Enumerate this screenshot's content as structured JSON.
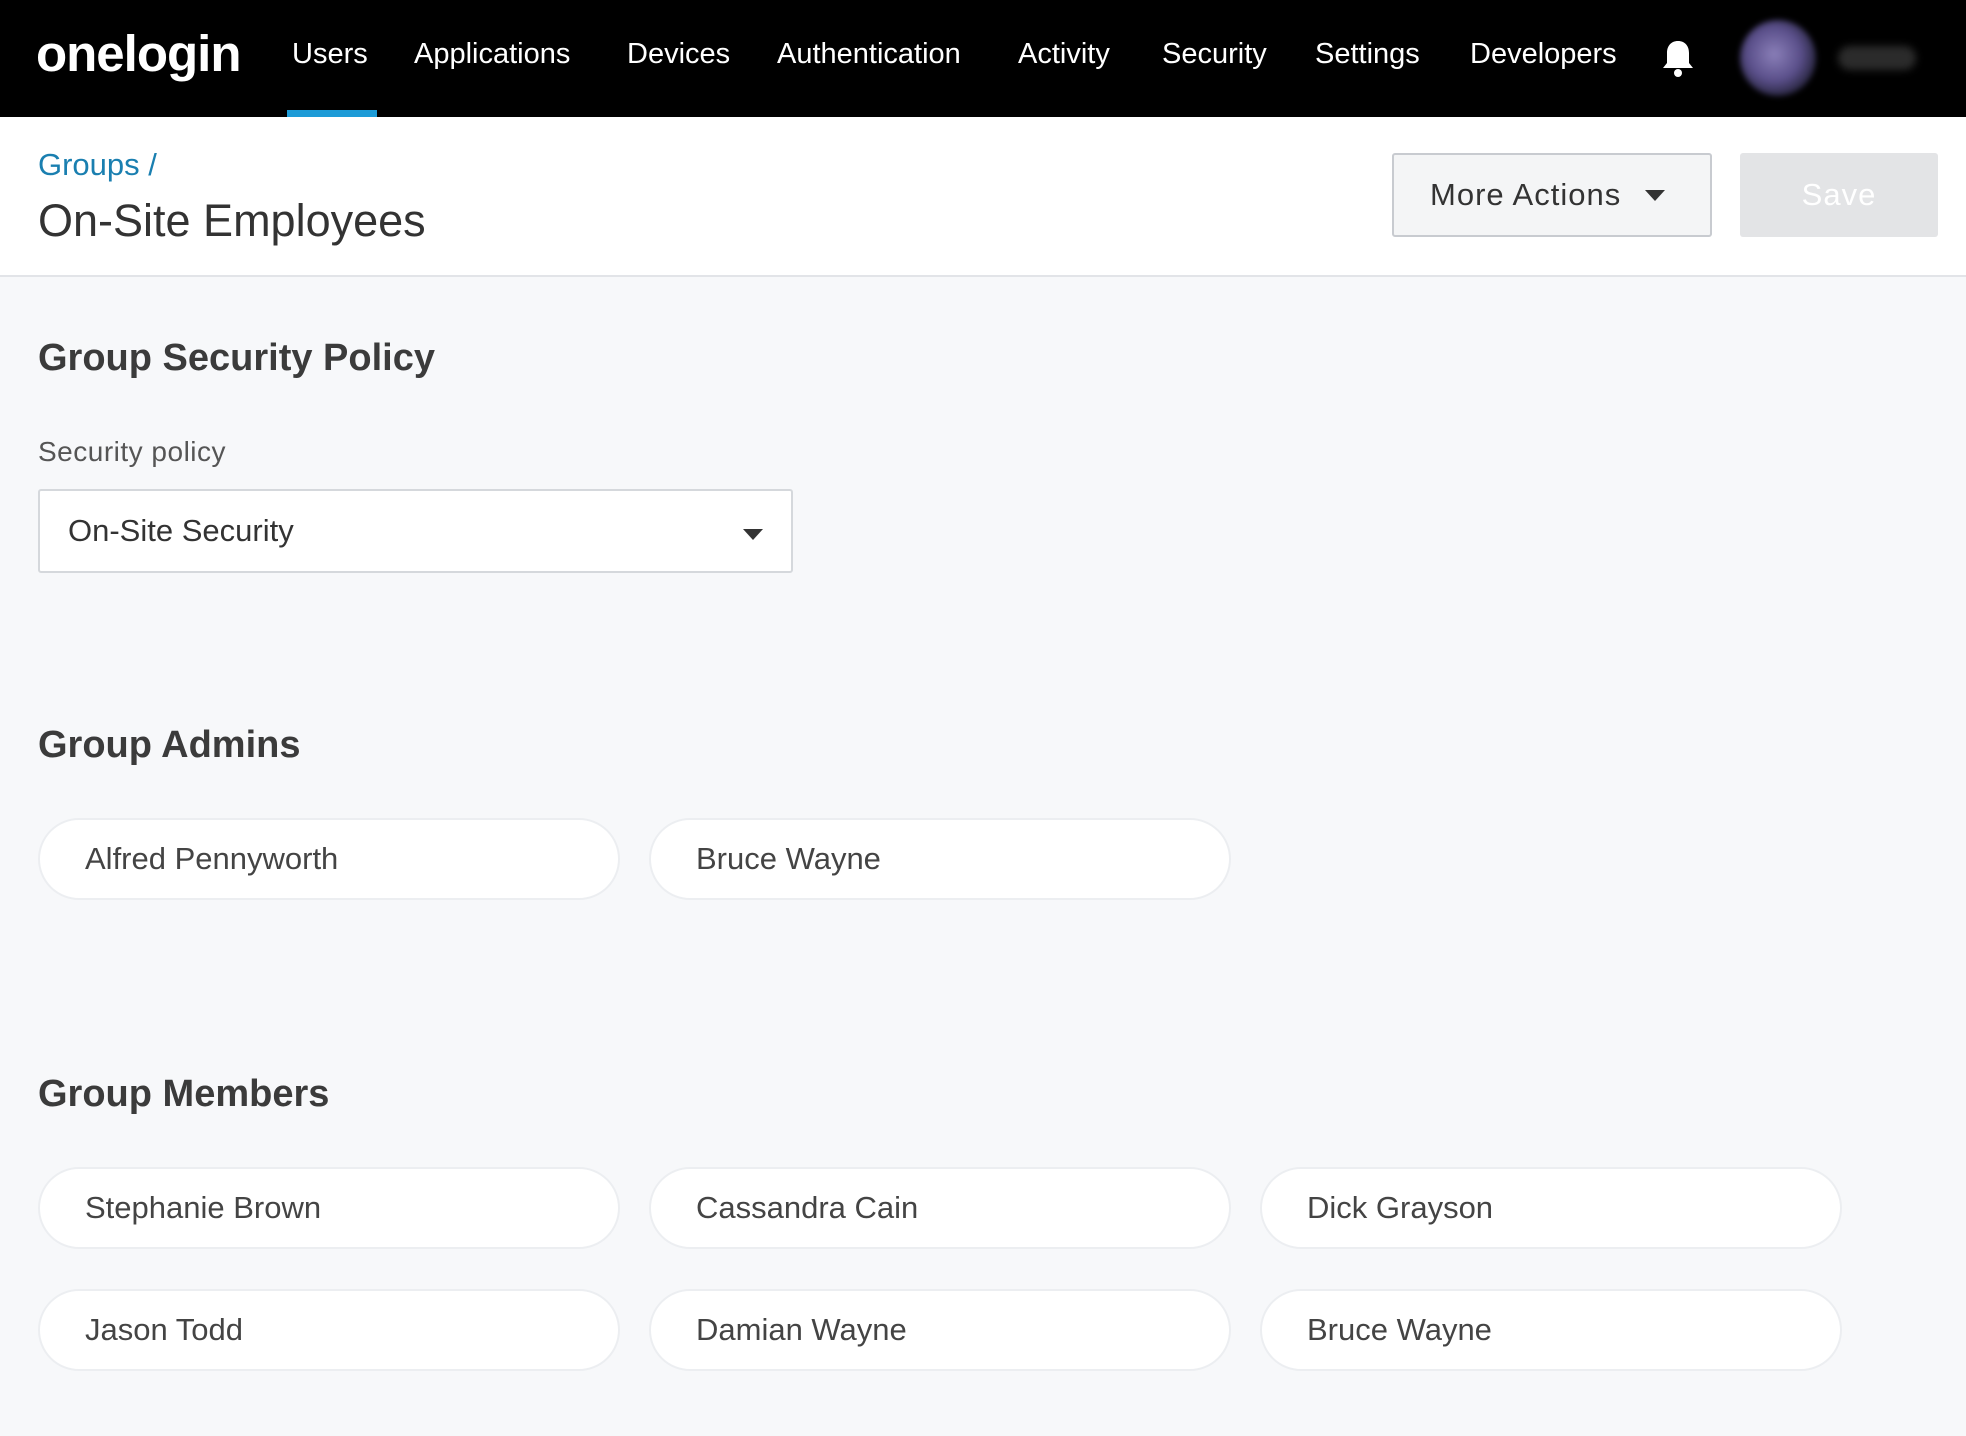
{
  "nav": {
    "logo": "onelogin",
    "items": [
      {
        "label": "Users",
        "active": true
      },
      {
        "label": "Applications"
      },
      {
        "label": "Devices"
      },
      {
        "label": "Authentication"
      },
      {
        "label": "Activity"
      },
      {
        "label": "Security"
      },
      {
        "label": "Settings"
      },
      {
        "label": "Developers"
      }
    ],
    "icons": {
      "notifications": "bell-icon",
      "avatar": "avatar"
    }
  },
  "header": {
    "breadcrumb": "Groups /",
    "title": "On-Site Employees",
    "more_actions_label": "More Actions",
    "save_label": "Save",
    "save_disabled": true
  },
  "security_policy": {
    "section_title": "Group Security Policy",
    "field_label": "Security policy",
    "selected": "On-Site Security"
  },
  "admins": {
    "section_title": "Group Admins",
    "items": [
      "Alfred Pennyworth",
      "Bruce Wayne"
    ]
  },
  "members": {
    "section_title": "Group Members",
    "items": [
      "Stephanie Brown",
      "Cassandra Cain",
      "Dick Grayson",
      "Jason Todd",
      "Damian Wayne",
      "Bruce Wayne"
    ]
  },
  "colors": {
    "nav_bg": "#000000",
    "accent": "#1c9bd7",
    "link": "#1a7fb0",
    "page_bg": "#f7f8fa"
  }
}
